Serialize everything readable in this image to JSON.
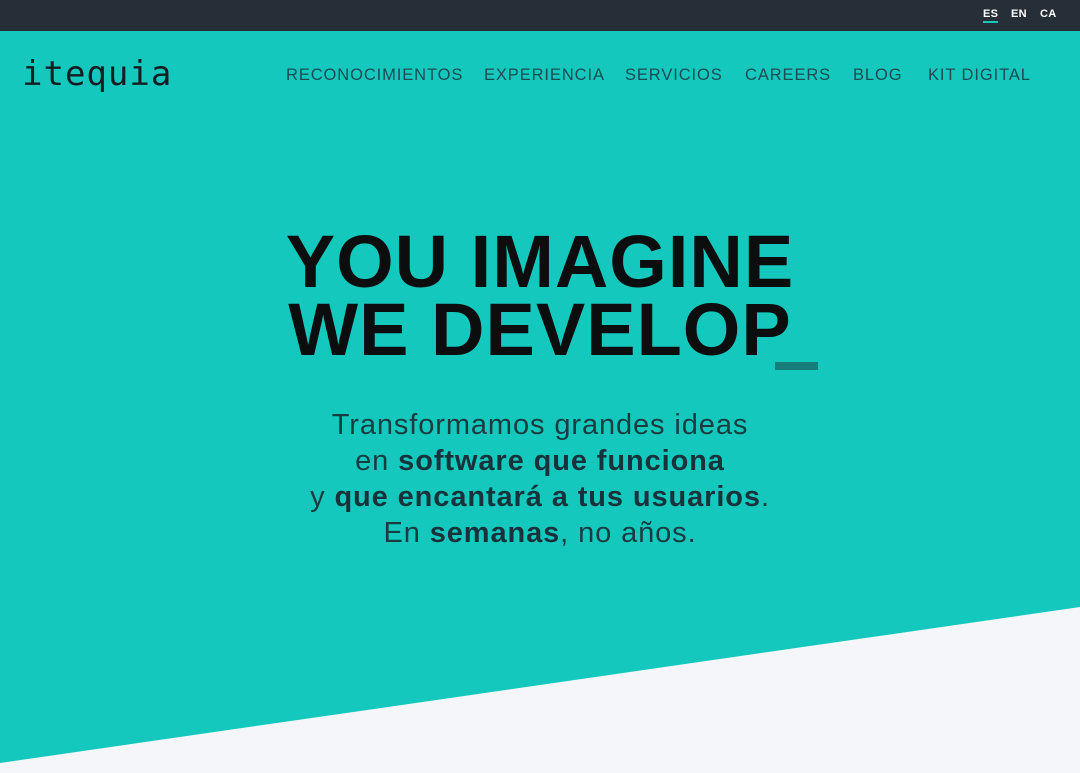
{
  "lang_bar": {
    "languages": [
      "ES",
      "EN",
      "CA"
    ],
    "active": "ES"
  },
  "brand": {
    "logo_text": "itequia"
  },
  "nav": {
    "items": [
      "RECONOCIMIENTOS",
      "EXPERIENCIA",
      "SERVICIOS",
      "CAREERS",
      "BLOG",
      "KIT DIGITAL"
    ]
  },
  "hero": {
    "headline_line1": "YOU IMAGINE",
    "headline_line2": "WE DEVELOP",
    "tagline": {
      "l1": "Transformamos grandes ideas",
      "l2_pre": "en ",
      "l2_bold": "software que funciona",
      "l3_pre": "y ",
      "l3_bold": "que encantará a tus usuarios",
      "l3_post": ".",
      "l4_pre": "En ",
      "l4_bold": "semanas",
      "l4_post": ", no años."
    }
  },
  "colors": {
    "hero_bg": "#14c8bd",
    "topbar_bg": "#262f37",
    "accent_cursor": "#167d7c",
    "wedge_bg": "#f4f6f9"
  }
}
